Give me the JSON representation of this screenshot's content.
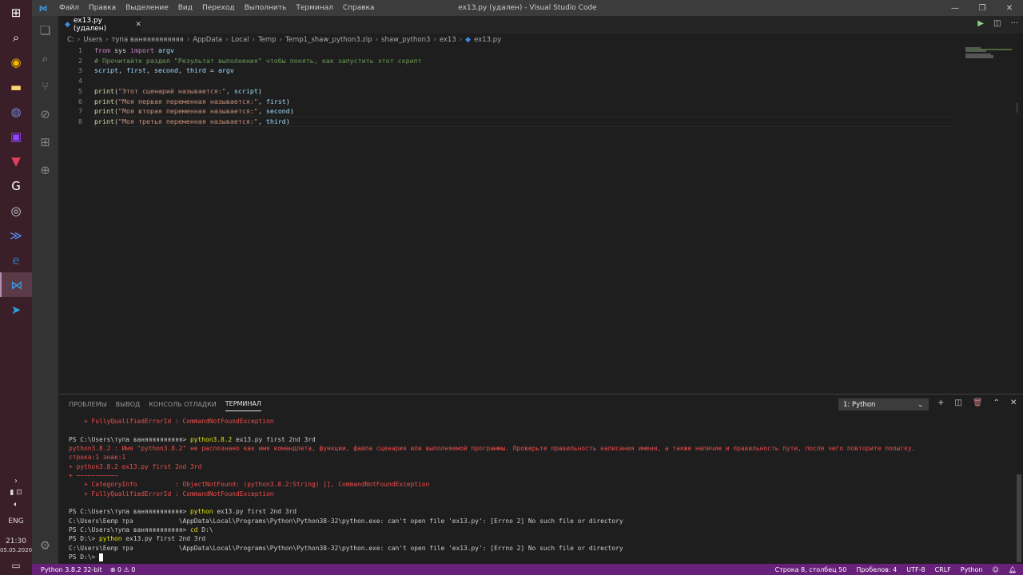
{
  "window": {
    "title": "ex13.py (удален) - Visual Studio Code",
    "menu": [
      "Файл",
      "Правка",
      "Выделение",
      "Вид",
      "Переход",
      "Выполнить",
      "Терминал",
      "Справка"
    ]
  },
  "taskbar": {
    "lang": "ENG",
    "time": "21:30",
    "date": "05.05.2020"
  },
  "tab": {
    "label": "ex13.py (удален)"
  },
  "breadcrumb": [
    "C:",
    "Users",
    "тупа ваняяяяяяяяяя",
    "AppData",
    "Local",
    "Temp",
    "Temp1_shaw_python3.zip",
    "shaw_python3",
    "ex13",
    "ex13.py"
  ],
  "editor": {
    "lines": [
      {
        "n": "1",
        "text": "from sys import argv"
      },
      {
        "n": "2",
        "text": "# Прочитайте раздел \"Результат выполнения\" чтобы понять, как запустить этот скрипт"
      },
      {
        "n": "3",
        "text": "script, first, second, third = argv"
      },
      {
        "n": "4",
        "text": ""
      },
      {
        "n": "5",
        "text": "print(\"Этот сценарий называется:\", script)"
      },
      {
        "n": "6",
        "text": "print(\"Моя первая переменная называется:\", first)"
      },
      {
        "n": "7",
        "text": "print(\"Моя вторая переменная называется:\", second)"
      },
      {
        "n": "8",
        "text": "print(\"Моя третья переменная называется:\", third)"
      }
    ]
  },
  "panel": {
    "tabs": [
      "ПРОБЛЕМЫ",
      "ВЫВОД",
      "КОНСОЛЬ ОТЛАДКИ",
      "ТЕРМИНАЛ"
    ],
    "terminal_select": "1: Python",
    "terminal_lines": [
      {
        "text": "    + FullyQualifiedErrorId : CommandNotFoundException",
        "err": true
      },
      {
        "text": "",
        "err": false
      },
      {
        "prompt": "PS C:\\Users\\тупа ваняяяяяяяяяя> ",
        "cmd": "python3.8.2",
        "rest": " ex13.py first 2nd 3rd"
      },
      {
        "text": "python3.8.2 : Имя \"python3.8.2\" не распознано как имя командлета, функции, файла сценария или выполняемой программы. Проверьте правильность написания имени, а также наличие и правильность пути, после чего повторите попытку.",
        "err": true
      },
      {
        "text": "строка:1 знак:1",
        "err": true
      },
      {
        "text": "+ python3.8.2 ex13.py first 2nd 3rd",
        "err": true
      },
      {
        "text": "+ ~~~~~~~~~~~",
        "err": true
      },
      {
        "text": "    + CategoryInfo          : ObjectNotFound: (python3.8.2:String) [], CommandNotFoundException",
        "err": true
      },
      {
        "text": "    + FullyQualifiedErrorId : CommandNotFoundException",
        "err": true
      },
      {
        "text": "",
        "err": false
      },
      {
        "prompt": "PS C:\\Users\\тупа ваняяяяяяяяяя> ",
        "cmd": "python",
        "rest": " ex13.py first 2nd 3rd"
      },
      {
        "text": "C:\\Users\\Еелр трэ            \\AppData\\Local\\Programs\\Python\\Python38-32\\python.exe: can't open file 'ex13.py': [Errno 2] No such file or directory",
        "err": false
      },
      {
        "prompt": "PS C:\\Users\\тупа ваняяяяяяяяяя> ",
        "cmd": "cd",
        "rest": " D:\\"
      },
      {
        "prompt": "PS D:\\> ",
        "cmd": "python",
        "rest": " ex13.py first 2nd 3rd"
      },
      {
        "text": "C:\\Users\\Еелр трэ            \\AppData\\Local\\Programs\\Python\\Python38-32\\python.exe: can't open file 'ex13.py': [Errno 2] No such file or directory",
        "err": false
      },
      {
        "prompt": "PS D:\\> ",
        "cmd": "",
        "rest": "",
        "cursor": true
      }
    ]
  },
  "statusbar": {
    "python": "Python 3.8.2 32-bit",
    "problems": "⊗ 0 ⚠ 0",
    "position": "Строка 8, столбец 50",
    "spaces": "Пробелов: 4",
    "encoding": "UTF-8",
    "eol": "CRLF",
    "language": "Python"
  },
  "colors": {
    "statusbar": "#68217a",
    "taskbar": "#3a1e28",
    "error": "#f14c4c",
    "command": "#e5e510"
  }
}
